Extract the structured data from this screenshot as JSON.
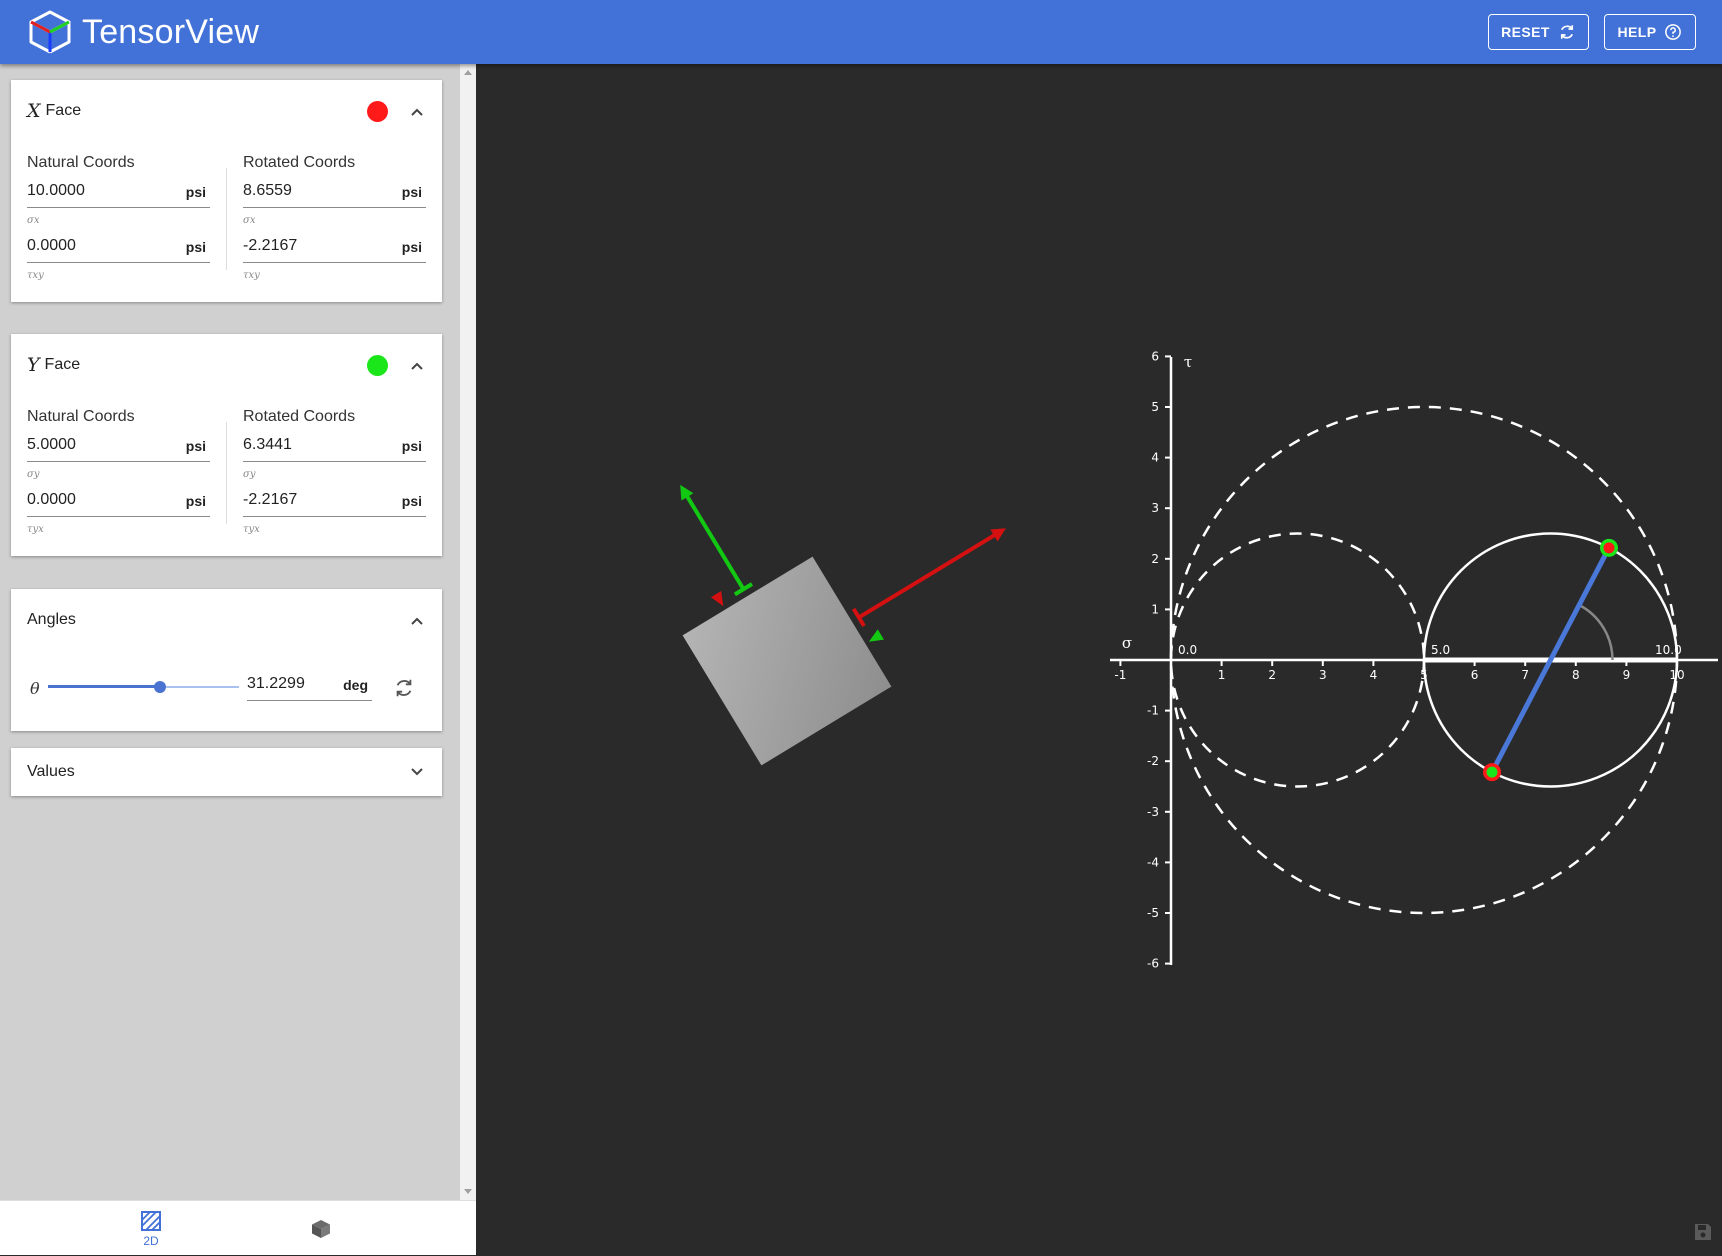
{
  "app": {
    "title": "TensorView"
  },
  "toolbar": {
    "reset_label": "RESET",
    "help_label": "HELP"
  },
  "x_face": {
    "symbol": "X",
    "label": "Face",
    "color": "#ff1a1a",
    "natural_title": "Natural Coords",
    "rotated_title": "Rotated Coords",
    "natural": [
      {
        "value": "10.0000",
        "unit": "psi",
        "symbol": "σx"
      },
      {
        "value": "0.0000",
        "unit": "psi",
        "symbol": "τxy"
      }
    ],
    "rotated": [
      {
        "value": "8.6559",
        "unit": "psi",
        "symbol": "σx"
      },
      {
        "value": "-2.2167",
        "unit": "psi",
        "symbol": "τxy"
      }
    ]
  },
  "y_face": {
    "symbol": "Y",
    "label": "Face",
    "color": "#1ae61a",
    "natural_title": "Natural Coords",
    "rotated_title": "Rotated Coords",
    "natural": [
      {
        "value": "5.0000",
        "unit": "psi",
        "symbol": "σy"
      },
      {
        "value": "0.0000",
        "unit": "psi",
        "symbol": "τyx"
      }
    ],
    "rotated": [
      {
        "value": "6.3441",
        "unit": "psi",
        "symbol": "σy"
      },
      {
        "value": "-2.2167",
        "unit": "psi",
        "symbol": "τyx"
      }
    ]
  },
  "angles": {
    "title": "Angles",
    "symbol": "θ",
    "value": "31.2299",
    "unit": "deg",
    "slider_fraction": 0.587
  },
  "values_panel": {
    "title": "Values"
  },
  "tabs": [
    {
      "label": "2D",
      "icon": "hatched-square-icon",
      "active": true
    },
    {
      "label": "",
      "icon": "cube-icon",
      "active": false
    }
  ],
  "element_view": {
    "rotation_deg": 31.2299,
    "element_color": "#a8a8a8",
    "x_arrow_color": "#d41010",
    "y_arrow_color": "#12c812"
  },
  "chart_data": {
    "type": "mohr-circle",
    "xlabel": "σ",
    "ylabel": "τ",
    "xlim": [
      -1,
      10.8
    ],
    "ylim": [
      -6,
      6
    ],
    "x_ticks": [
      -1,
      1,
      2,
      3,
      4,
      5,
      6,
      7,
      8,
      9,
      10
    ],
    "y_ticks": [
      -6,
      -5,
      -4,
      -3,
      -2,
      -1,
      1,
      2,
      3,
      4,
      5,
      6
    ],
    "point_labels": [
      {
        "sigma": 0.0,
        "text": "0.0"
      },
      {
        "sigma": 5.0,
        "text": "5.0"
      },
      {
        "sigma": 10.0,
        "text": "10.0"
      }
    ],
    "circles": [
      {
        "center": 7.5,
        "radius": 2.5,
        "style": "solid"
      },
      {
        "center": 2.5,
        "radius": 2.5,
        "style": "dashed"
      },
      {
        "center": 5.0,
        "radius": 5.0,
        "style": "dashed"
      }
    ],
    "principal_sigma": [
      0,
      5,
      10
    ],
    "diameter": {
      "color": "#4a78d8",
      "x_point": {
        "sigma": 8.6559,
        "tau": 2.2167
      },
      "y_point": {
        "sigma": 6.3441,
        "tau": -2.2167
      }
    },
    "x_point_color": "#ff1a1a",
    "y_point_color": "#1ae61a",
    "angle_arc_deg": 62.4598
  }
}
